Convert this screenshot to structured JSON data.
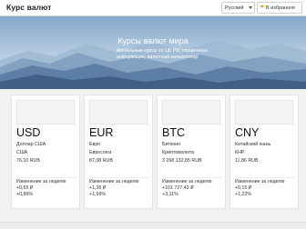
{
  "header": {
    "brand": "Курс валют",
    "language": "Русский",
    "favorites_label": "В избранное"
  },
  "hero": {
    "title": "Курсы валют мира",
    "text": "Актуальные курсы по ЦБ РФ, справочная информация, валютный калькулятор."
  },
  "cards": [
    {
      "code": "USD",
      "name": "Доллар США",
      "sub": "США",
      "price": "76,10 RUB",
      "rate": "",
      "change_label": "Изменение за неделю",
      "change_value": "+0,65 ₽",
      "change_pct": "+0,86%"
    },
    {
      "code": "EUR",
      "name": "Евро",
      "sub": "Евросоюз",
      "price": "87,08 RUB",
      "rate": "",
      "change_label": "Изменение за неделю",
      "change_value": "+1,36 ₽",
      "change_pct": "+1,56%"
    },
    {
      "code": "BTC",
      "name": "Биткоин",
      "sub": "Криптовалюта",
      "price": "3 268 132,85 RUB",
      "rate": "",
      "change_label": "Изменение за неделю",
      "change_value": "+101 727,43 ₽",
      "change_pct": "+3,11%"
    },
    {
      "code": "CNY",
      "name": "Китайский юань",
      "sub": "КНР",
      "price": "11,86 RUB",
      "rate": "",
      "change_label": "Изменение за неделю",
      "change_value": "+0,15 ₽",
      "change_pct": "+1,22%"
    }
  ],
  "colors": {
    "sky_top": "#8fb3d2",
    "sky_mid": "#b4cbe0",
    "mountain_far": "#7f9fbf",
    "mountain_mid": "#5d7fa5",
    "mountain_near": "#3f5f85",
    "header_bg": "#ffffff",
    "page_bg": "#f2f2f2"
  }
}
